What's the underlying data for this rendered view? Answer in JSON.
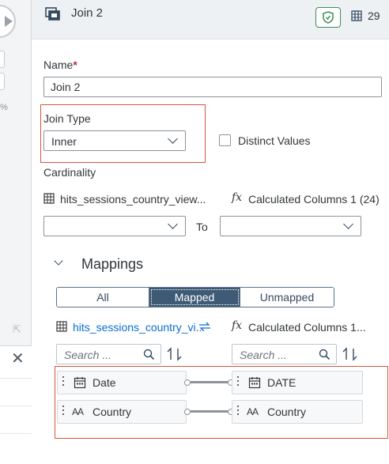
{
  "background": {
    "percent_fragment": "%"
  },
  "header": {
    "title": "Join 2",
    "column_count": "29"
  },
  "form": {
    "name_label": "Name",
    "name_required": "*",
    "name_value": "Join 2",
    "join_type_label": "Join Type",
    "join_type_value": "Inner",
    "distinct_label": "Distinct Values",
    "cardinality_label": "Cardinality",
    "left_source": "hits_sessions_country_view...",
    "right_source": "Calculated Columns 1 (24)",
    "to_label": "To",
    "left_cardinality_value": "",
    "right_cardinality_value": ""
  },
  "mappings": {
    "section_title": "Mappings",
    "filter_options": [
      "All",
      "Mapped",
      "Unmapped"
    ],
    "selected_filter": "Mapped",
    "left_source_link": "hits_sessions_country_vi...",
    "right_source": "Calculated Columns 1...",
    "search_placeholder_left": "Search ...",
    "search_placeholder_right": "Search ...",
    "rows": [
      {
        "left": "Date",
        "left_type": "date",
        "right": "DATE",
        "right_type": "date"
      },
      {
        "left": "Country",
        "left_type": "string",
        "right": "Country",
        "right_type": "string"
      }
    ]
  },
  "colors": {
    "highlight": "#d9533f",
    "selected_segment": "#3e5a75",
    "link": "#0a6ed1",
    "shield_green": "#3d8c5a"
  },
  "icons": {
    "node": "join-node-icon",
    "shield": "shield-icon",
    "columns": "columns-icon",
    "table": "table-icon",
    "function": "function-fx-icon",
    "search": "search-icon",
    "sort": "sort-icon",
    "swap": "swap-icon",
    "calendar": "calendar-icon",
    "text_type": "text-type-icon"
  }
}
